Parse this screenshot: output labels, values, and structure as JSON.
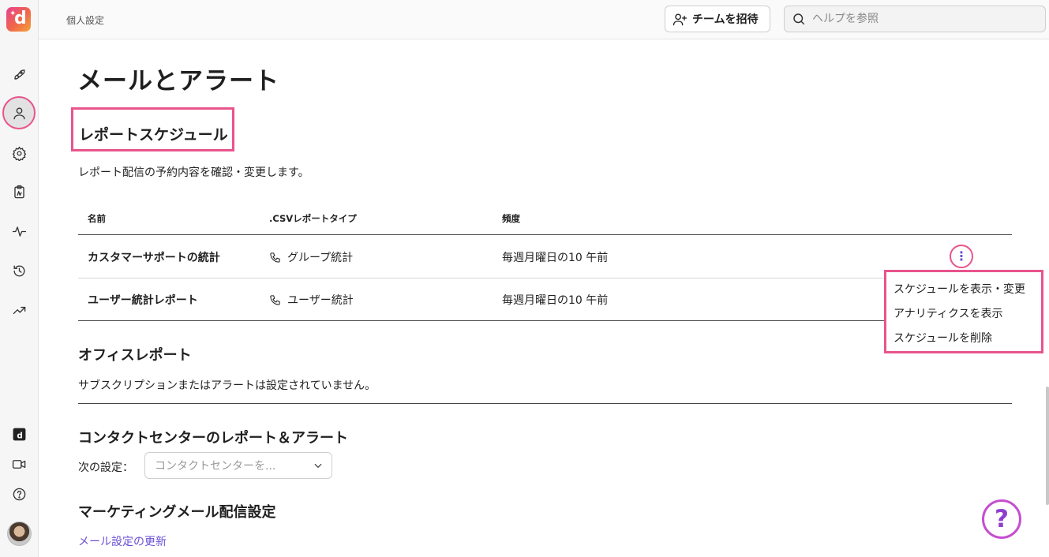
{
  "topbar": {
    "breadcrumb": "個人設定",
    "invite_label": "チームを招待",
    "search_placeholder": "ヘルプを参照"
  },
  "page": {
    "title": "メールとアラート"
  },
  "report_schedule": {
    "title": "レポートスケジュール",
    "description": "レポート配信の予約内容を確認・変更します。",
    "columns": [
      "名前",
      ".CSVレポートタイプ",
      "頻度"
    ],
    "rows": [
      {
        "name": "カスタマーサポートの統計",
        "type": "グループ統計",
        "frequency": "毎週月曜日の10 午前"
      },
      {
        "name": "ユーザー統計レポート",
        "type": "ユーザー統計",
        "frequency": "毎週月曜日の10 午前"
      }
    ],
    "row_menu": {
      "kebab_glyph": "⋮",
      "items": [
        "スケジュールを表示・変更",
        "アナリティクスを表示",
        "スケジュールを削除"
      ]
    }
  },
  "office_reports": {
    "title": "オフィスレポート",
    "empty_text": "サブスクリプションまたはアラートは設定されていません。"
  },
  "contact_center": {
    "title": "コンタクトセンターのレポート＆アラート",
    "select_label": "次の設定：",
    "select_placeholder": "コンタクトセンターを..."
  },
  "marketing": {
    "title": "マーケティングメール配信設定",
    "link_text": "メール設定の更新"
  },
  "help_fab": {
    "glyph": "?"
  },
  "colors": {
    "highlight": "#e8548c",
    "accent": "#6a4fd8"
  }
}
